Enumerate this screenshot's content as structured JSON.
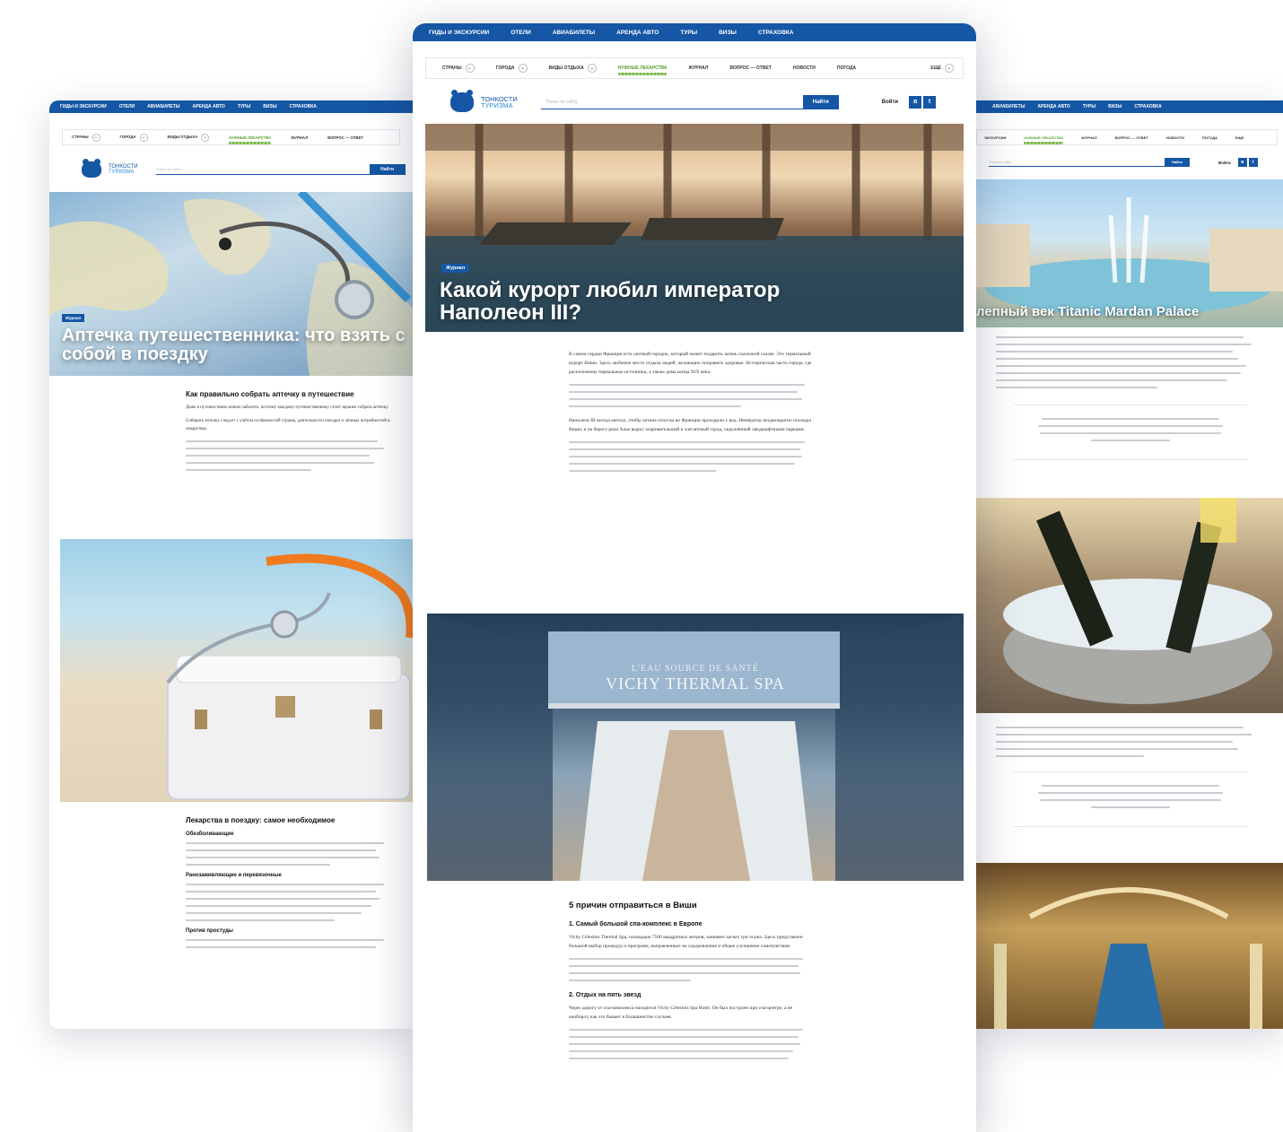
{
  "nav": [
    "Гиды и экскурсии",
    "Отели",
    "Авиабилеты",
    "Аренда авто",
    "Туры",
    "Визы",
    "Страховка"
  ],
  "right_nav": [
    "Авиабилеты",
    "Аренда авто",
    "Туры",
    "Визы",
    "Страховка"
  ],
  "subnav": [
    "Страны",
    "Города",
    "Виды отдыха",
    "Нужные лекарства",
    "Журнал",
    "Вопрос — ответ",
    "Новости",
    "Погода",
    "Еще"
  ],
  "right_subnav": [
    "Экскурсии",
    "Нужные лекарства",
    "Журнал",
    "Вопрос — ответ",
    "Новости",
    "Погода",
    "Еще"
  ],
  "left_subnav": [
    "Страны",
    "Города",
    "Виды отдыха",
    "Нужные лекарства",
    "Журнал",
    "Вопрос — ответ"
  ],
  "logo": {
    "line1": "ТОНКОСТИ",
    "line2": "ТУРИЗМА"
  },
  "search": {
    "placeholder": "Поиск по сайту",
    "button": "Найти"
  },
  "login": "Войти",
  "social": [
    "vk",
    "tw"
  ],
  "main": {
    "tag": "Журнал",
    "title": "Какой курорт любил император Наполеон III?",
    "para1": "В самом сердце Франции есть уютный городок, который может подарить жизнь сказочной сказке. Это термальный курорт Виши. Здесь любимое место отдыха людей, желающих поправить здоровье. Историческая часть города, где расположены термальные источники, а также дома конца XIX века.",
    "para2": "Наполеон III всегда мечтал, чтобы летние отпуска во Франции проходили у вод. Император неоднократно посещал Виши, и на берегу реки Алье вырос очаровательный и элегантный город, окружённый ландшафтными парками.",
    "photo_sign_1": "L'EAU SOURCE DE SANTÉ",
    "photo_sign_2": "VICHY THERMAL SPA",
    "h2": "5 причин отправиться в Виши",
    "h3a": "1. Самый большой спа-комплекс в Европе",
    "p3a": "Vichy Célestins Thermal Spa, площадью 7500 квадратных метров, занимает целых три этажа. Здесь представлен большой выбор процедур и программ, направленных на оздоровление и общее улучшение самочувствия.",
    "h3b": "2. Отдых на пять звезд",
    "p3b": "Через дорогу от спа-комплекса находится Vichy Célestins Spa Hotel. Он был построен при спа-центре, а не наоборот, как это бывает в большинстве случаев."
  },
  "left": {
    "tag": "Журнал",
    "title": "Аптечка путешественника: что взять с собой в поездку",
    "h2a": "Как правильно собрать аптечку в путешествие",
    "p1": "Даже в путешествиях можно заболеть, поэтому каждому путешественнику стоит заранее собрать аптечку.",
    "p2": "Собирать аптечку следует с учётом особенностей страны, длительности поездки и личных потребностей в лекарствах.",
    "h2b": "Лекарства в поездку: самое необходимое",
    "h3a": "Обезболивающие",
    "h3b": "Ранозаживляющие и перевязочные",
    "h3c": "Против простуды"
  },
  "right": {
    "title": "лепный век Titanic Mardan Palace"
  },
  "colors": {
    "brand": "#1556a5",
    "accent_green": "#5aa130",
    "link": "#2c8ed6"
  }
}
